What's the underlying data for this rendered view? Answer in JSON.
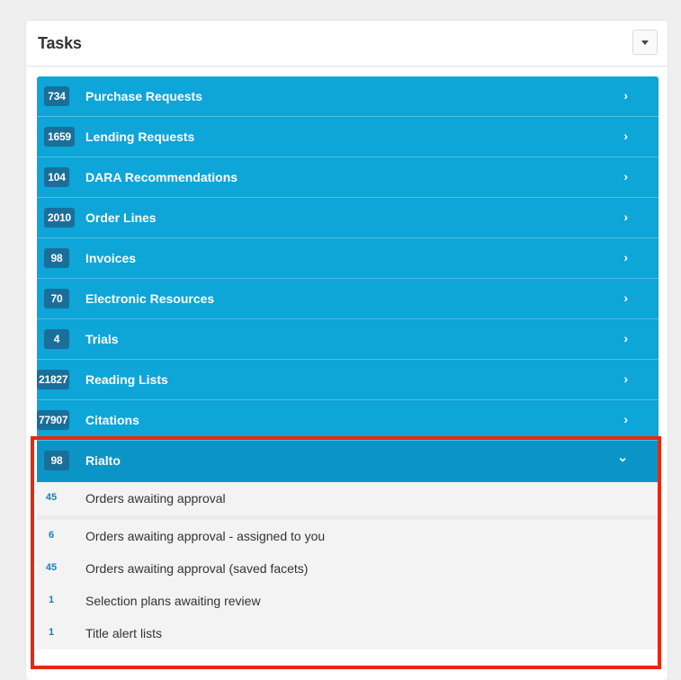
{
  "panel": {
    "title": "Tasks"
  },
  "tasks": [
    {
      "count": "734",
      "label": "Purchase Requests"
    },
    {
      "count": "1659",
      "label": "Lending Requests"
    },
    {
      "count": "104",
      "label": "DARA Recommendations"
    },
    {
      "count": "2010",
      "label": "Order Lines"
    },
    {
      "count": "98",
      "label": "Invoices"
    },
    {
      "count": "70",
      "label": "Electronic Resources"
    },
    {
      "count": "4",
      "label": "Trials"
    },
    {
      "count": "21827",
      "label": "Reading Lists"
    },
    {
      "count": "77907",
      "label": "Citations"
    },
    {
      "count": "98",
      "label": "Rialto"
    }
  ],
  "rialto_items": [
    {
      "count": "45",
      "label": "Orders awaiting approval"
    },
    {
      "count": "6",
      "label": "Orders awaiting approval - assigned to you"
    },
    {
      "count": "45",
      "label": "Orders awaiting approval (saved facets)"
    },
    {
      "count": "1",
      "label": "Selection plans awaiting review"
    },
    {
      "count": "1",
      "label": "Title alert lists"
    }
  ],
  "icons": {
    "collapse": "caret-down-icon",
    "row_arrow": "chevron-right-icon",
    "expanded_arrow": "chevron-down-icon"
  },
  "colors": {
    "task_row": "#0ea5d8",
    "task_row_open": "#0b95c7",
    "count_badge": "#1a6f9a",
    "highlight": "#e8280f"
  },
  "glyphs": {
    "chevron_right": "›",
    "chevron_down": "⌄"
  }
}
